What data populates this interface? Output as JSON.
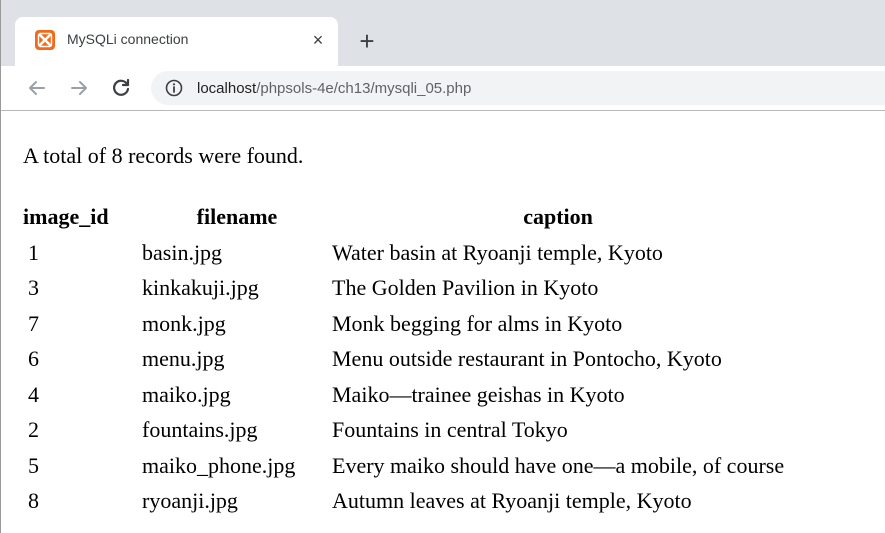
{
  "browser": {
    "tab_title": "MySQLi connection",
    "tab_close": "×",
    "new_tab": "+",
    "url_host": "localhost",
    "url_path": "/phpsols-4e/ch13/mysqli_05.php"
  },
  "page": {
    "summary": "A total of 8 records were found.",
    "table": {
      "headers": [
        "image_id",
        "filename",
        "caption"
      ],
      "rows": [
        [
          "1",
          "basin.jpg",
          "Water basin at Ryoanji temple, Kyoto"
        ],
        [
          "3",
          "kinkakuji.jpg",
          "The Golden Pavilion in Kyoto"
        ],
        [
          "7",
          "monk.jpg",
          "Monk begging for alms in Kyoto"
        ],
        [
          "6",
          "menu.jpg",
          "Menu outside restaurant in Pontocho, Kyoto"
        ],
        [
          "4",
          "maiko.jpg",
          "Maiko—trainee geishas in Kyoto"
        ],
        [
          "2",
          "fountains.jpg",
          "Fountains in central Tokyo"
        ],
        [
          "5",
          "maiko_phone.jpg",
          "Every maiko should have one—a mobile, of course"
        ],
        [
          "8",
          "ryoanji.jpg",
          "Autumn leaves at Ryoanji temple, Kyoto"
        ]
      ]
    }
  },
  "icons": {
    "favicon": "xampp-icon",
    "back": "arrow-left-icon",
    "forward": "arrow-right-icon",
    "reload": "reload-icon",
    "info": "info-icon"
  },
  "colors": {
    "tabstrip": "#dee1e6",
    "omnibox": "#f1f3f4",
    "favicon": "#f26b1d"
  }
}
